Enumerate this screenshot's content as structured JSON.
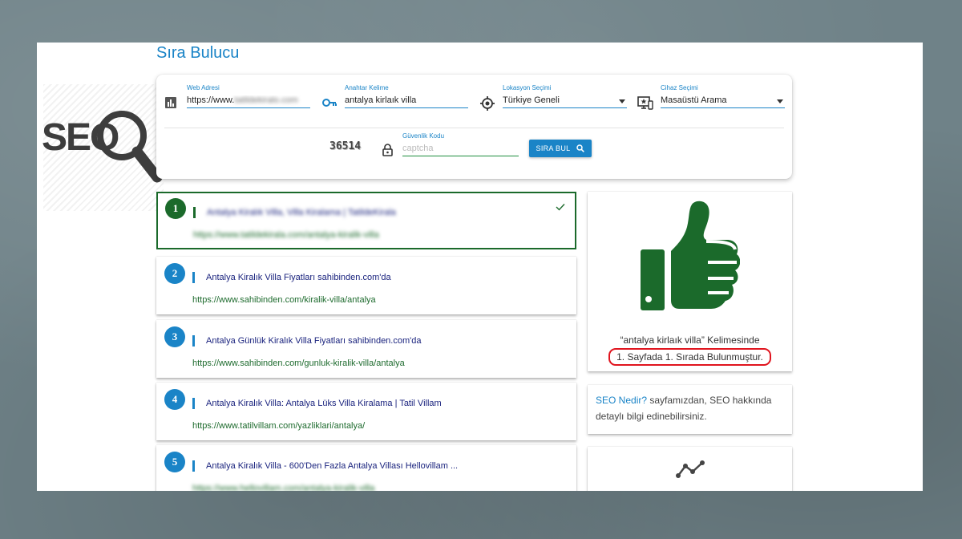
{
  "page_title": "Sıra Bulucu",
  "form": {
    "web_address": {
      "label": "Web Adresi",
      "prefix": "https://www.",
      "hidden_value": "tatildekiralo.com",
      "icon": "bar-chart-icon"
    },
    "keyword": {
      "label": "Anahtar Kelime",
      "value": "antalya kirlaık villa",
      "icon": "key-icon"
    },
    "location": {
      "label": "Lokasyon Seçimi",
      "value": "Türkiye Geneli",
      "icon": "location-target-icon"
    },
    "device": {
      "label": "Cihaz Seçimi",
      "value": "Masaüstü Arama",
      "icon": "desktop-device-icon"
    },
    "captcha": {
      "label": "Güvenlik Kodu",
      "image_text": "36514",
      "placeholder": "captcha",
      "icon": "lock-icon"
    },
    "search_button": {
      "label": "SIRA BUL",
      "icon": "search-icon"
    }
  },
  "results": [
    {
      "rank": "1",
      "title": "Antalya Kiralık Villa, Villa Kiralama | TatildeKirala",
      "url": "https://www.tatildekirala.com/antalya-kiralik-villa",
      "active": true
    },
    {
      "rank": "2",
      "title": "Antalya Kiralık Villa Fiyatları sahibinden.com'da",
      "url": "https://www.sahibinden.com/kiralik-villa/antalya"
    },
    {
      "rank": "3",
      "title": "Antalya Günlük Kiralık Villa Fiyatları sahibinden.com'da",
      "url": "https://www.sahibinden.com/gunluk-kiralik-villa/antalya"
    },
    {
      "rank": "4",
      "title": "Antalya Kiralık Villa: Antalya Lüks Villa Kiralama | Tatil Villam",
      "url": "https://www.tatilvillam.com/yazliklari/antalya/"
    },
    {
      "rank": "5",
      "title": "Antalya Kiralık Villa - 600'Den Fazla Antalya Villası Hellovillam ...",
      "url": "https://www.hellovillam.com/antalya-kiralik-villa"
    }
  ],
  "result_card": {
    "line1": "“antalya kirlaık villa” Kelimesinde",
    "line2": "1. Sayfada 1. Sırada Bulunmuştur.",
    "icon": "thumbs-up-icon"
  },
  "info_card": {
    "link": "SEO Nedir?",
    "text": " sayfamızdan, SEO hakkında detaylı bilgi edinebilirsiniz."
  },
  "bottom_card": {
    "icon": "trending-icon"
  },
  "logo": {
    "text": "SEO"
  },
  "colors": {
    "accent": "#1a84c7",
    "success": "#1b6a2b",
    "highlight": "#e0141e"
  }
}
